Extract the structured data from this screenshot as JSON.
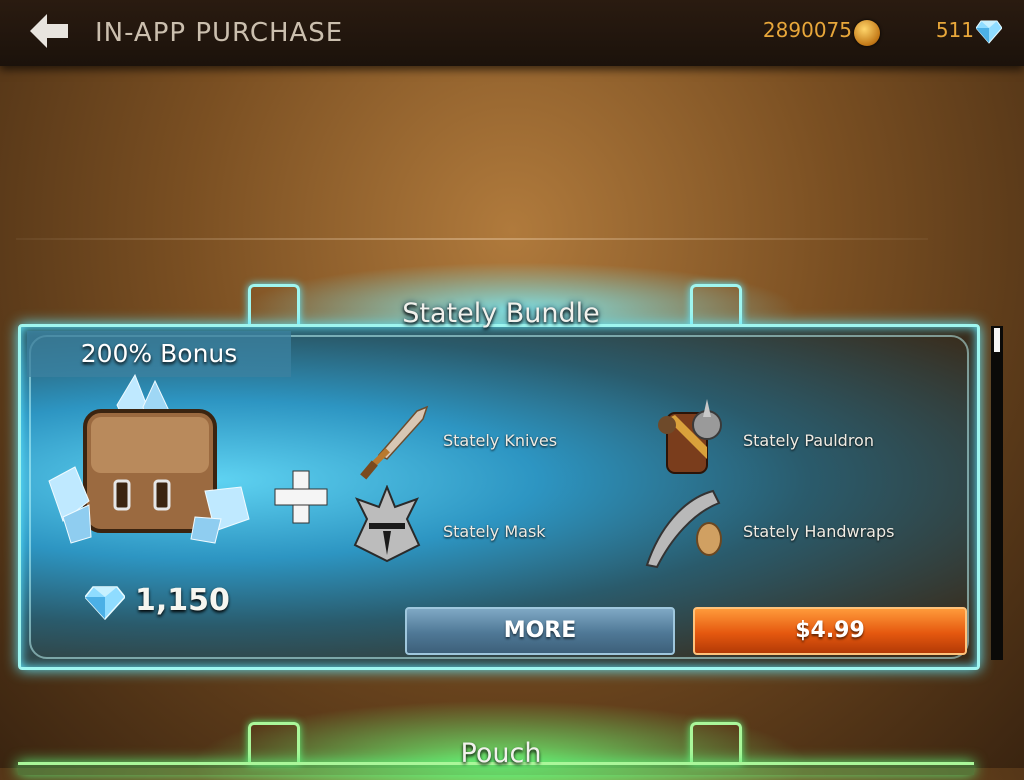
{
  "header": {
    "title": "IN-APP PURCHASE",
    "gold": "2890075",
    "gems": "511"
  },
  "bundle": {
    "title": "Stately Bundle",
    "bonus": "200% Bonus",
    "gem_amount": "1,150",
    "items": [
      {
        "label": "Stately Knives",
        "icon": "knife-icon"
      },
      {
        "label": "Stately Pauldron",
        "icon": "pauldron-icon"
      },
      {
        "label": "Stately Mask",
        "icon": "mask-icon"
      },
      {
        "label": "Stately Handwraps",
        "icon": "handwraps-icon"
      }
    ],
    "more_label": "MORE",
    "price_label": "$4.99"
  },
  "next_bundle": {
    "title": "Pouch"
  },
  "colors": {
    "accent_gold": "#e8a73a",
    "card_border": "#9ff6f0",
    "price_button": "#e5580f",
    "more_button": "#4f7896",
    "next_card_border": "#aaf79a"
  }
}
